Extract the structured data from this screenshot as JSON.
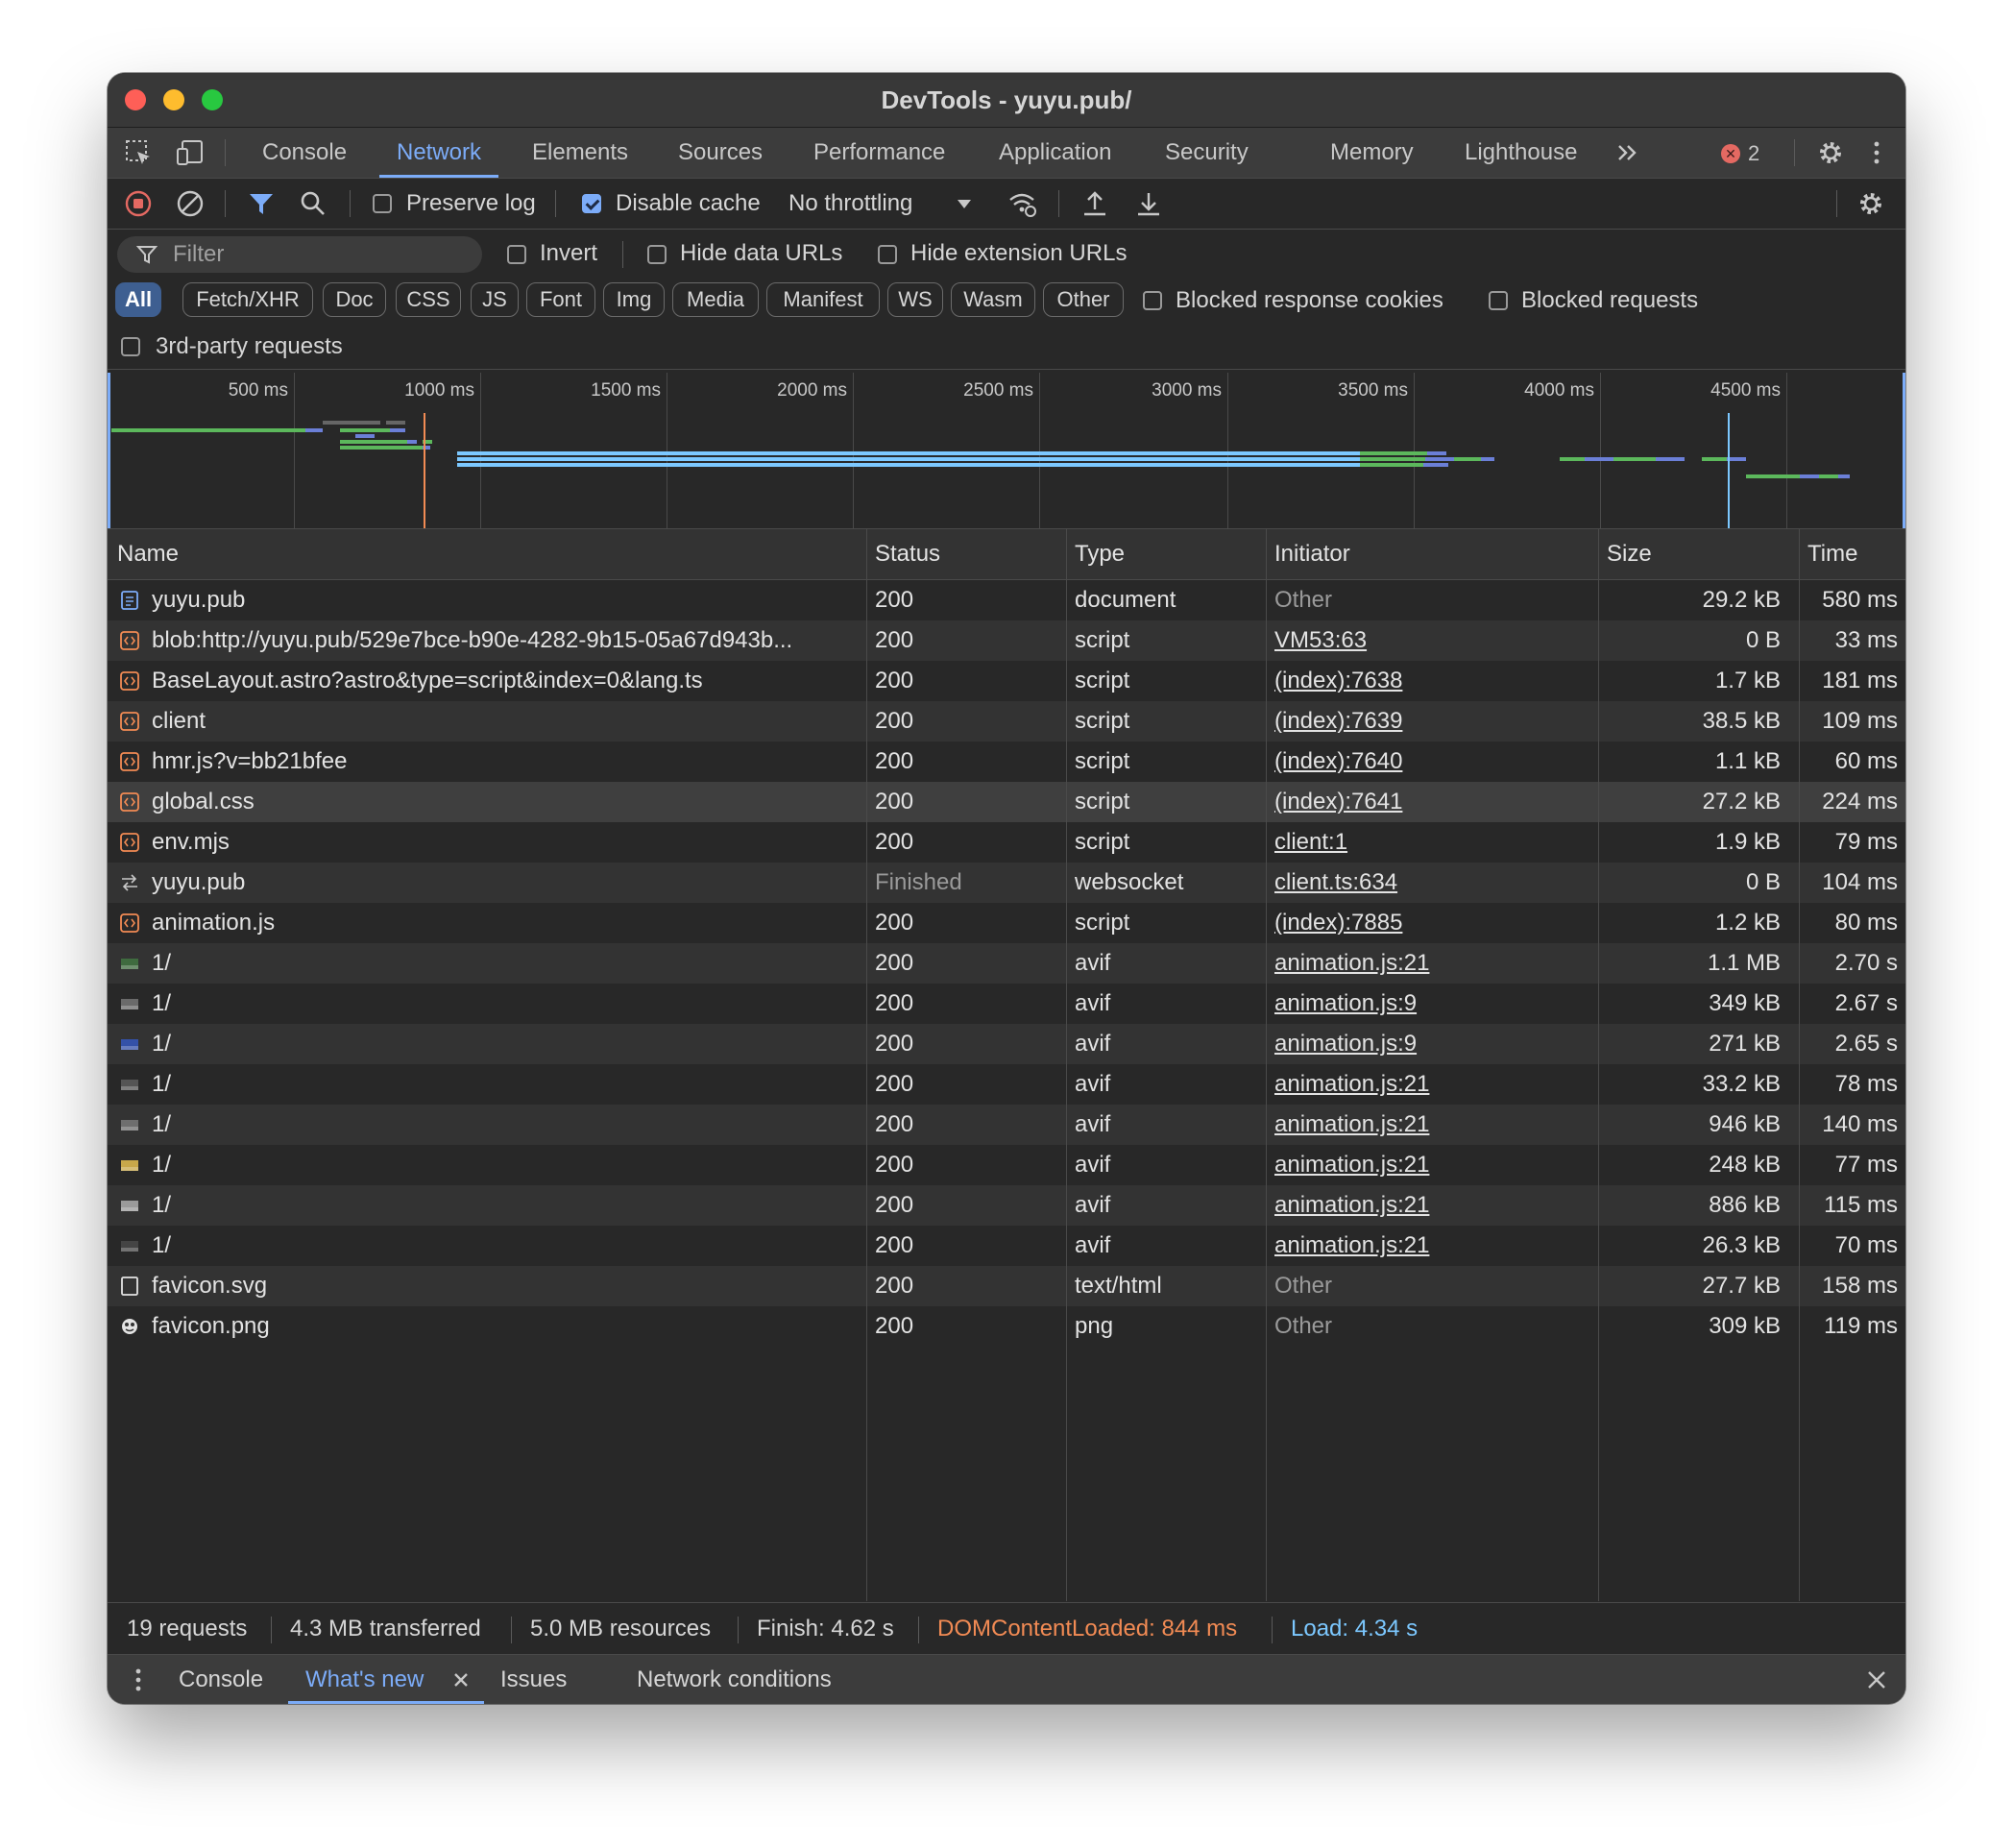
{
  "window": {
    "title": "DevTools - yuyu.pub/"
  },
  "tabs": [
    "Console",
    "Network",
    "Elements",
    "Sources",
    "Performance",
    "Application",
    "Security",
    "Memory",
    "Lighthouse"
  ],
  "active_tab": "Network",
  "error_count": "2",
  "toolbar": {
    "preserve_log": "Preserve log",
    "disable_cache": "Disable cache",
    "throttling": "No throttling"
  },
  "filter": {
    "placeholder": "Filter",
    "invert": "Invert",
    "hide_data_urls": "Hide data URLs",
    "hide_extension_urls": "Hide extension URLs",
    "types": [
      "All",
      "Fetch/XHR",
      "Doc",
      "CSS",
      "JS",
      "Font",
      "Img",
      "Media",
      "Manifest",
      "WS",
      "Wasm",
      "Other"
    ],
    "blocked_response_cookies": "Blocked response cookies",
    "blocked_requests": "Blocked requests",
    "third_party": "3rd-party requests"
  },
  "overview": {
    "ticks": [
      "500 ms",
      "1000 ms",
      "1500 ms",
      "2000 ms",
      "2500 ms",
      "3000 ms",
      "3500 ms",
      "4000 ms",
      "4500 ms"
    ]
  },
  "table": {
    "headers": {
      "name": "Name",
      "status": "Status",
      "type": "Type",
      "initiator": "Initiator",
      "size": "Size",
      "time": "Time"
    },
    "rows": [
      {
        "name": "yuyu.pub",
        "status": "200",
        "type": "document",
        "initiator": "Other",
        "size": "29.2 kB",
        "time": "580 ms",
        "icon": "document-icon"
      },
      {
        "name": "blob:http://yuyu.pub/529e7bce-b90e-4282-9b15-05a67d943b...",
        "status": "200",
        "type": "script",
        "initiator": "VM53:63",
        "size": "0 B",
        "time": "33 ms",
        "icon": "script-icon"
      },
      {
        "name": "BaseLayout.astro?astro&type=script&index=0&lang.ts",
        "status": "200",
        "type": "script",
        "initiator": "(index):7638",
        "size": "1.7 kB",
        "time": "181 ms",
        "icon": "script-icon"
      },
      {
        "name": "client",
        "status": "200",
        "type": "script",
        "initiator": "(index):7639",
        "size": "38.5 kB",
        "time": "109 ms",
        "icon": "script-icon"
      },
      {
        "name": "hmr.js?v=bb21bfee",
        "status": "200",
        "type": "script",
        "initiator": "(index):7640",
        "size": "1.1 kB",
        "time": "60 ms",
        "icon": "script-icon"
      },
      {
        "name": "global.css",
        "status": "200",
        "type": "script",
        "initiator": "(index):7641",
        "size": "27.2 kB",
        "time": "224 ms",
        "icon": "script-icon"
      },
      {
        "name": "env.mjs",
        "status": "200",
        "type": "script",
        "initiator": "client:1",
        "size": "1.9 kB",
        "time": "79 ms",
        "icon": "script-icon"
      },
      {
        "name": "yuyu.pub",
        "status": "Finished",
        "type": "websocket",
        "initiator": "client.ts:634",
        "size": "0 B",
        "time": "104 ms",
        "icon": "websocket-icon"
      },
      {
        "name": "animation.js",
        "status": "200",
        "type": "script",
        "initiator": "(index):7885",
        "size": "1.2 kB",
        "time": "80 ms",
        "icon": "script-icon"
      },
      {
        "name": "1/",
        "status": "200",
        "type": "avif",
        "initiator": "animation.js:21",
        "size": "1.1 MB",
        "time": "2.70 s",
        "icon": "image-thumbnail-icon"
      },
      {
        "name": "1/",
        "status": "200",
        "type": "avif",
        "initiator": "animation.js:9",
        "size": "349 kB",
        "time": "2.67 s",
        "icon": "image-thumbnail-icon"
      },
      {
        "name": "1/",
        "status": "200",
        "type": "avif",
        "initiator": "animation.js:9",
        "size": "271 kB",
        "time": "2.65 s",
        "icon": "image-thumbnail-icon"
      },
      {
        "name": "1/",
        "status": "200",
        "type": "avif",
        "initiator": "animation.js:21",
        "size": "33.2 kB",
        "time": "78 ms",
        "icon": "image-thumbnail-icon"
      },
      {
        "name": "1/",
        "status": "200",
        "type": "avif",
        "initiator": "animation.js:21",
        "size": "946 kB",
        "time": "140 ms",
        "icon": "image-thumbnail-icon"
      },
      {
        "name": "1/",
        "status": "200",
        "type": "avif",
        "initiator": "animation.js:21",
        "size": "248 kB",
        "time": "77 ms",
        "icon": "image-thumbnail-icon"
      },
      {
        "name": "1/",
        "status": "200",
        "type": "avif",
        "initiator": "animation.js:21",
        "size": "886 kB",
        "time": "115 ms",
        "icon": "image-thumbnail-icon"
      },
      {
        "name": "1/",
        "status": "200",
        "type": "avif",
        "initiator": "animation.js:21",
        "size": "26.3 kB",
        "time": "70 ms",
        "icon": "image-thumbnail-icon"
      },
      {
        "name": "favicon.svg",
        "status": "200",
        "type": "text/html",
        "initiator": "Other",
        "size": "27.7 kB",
        "time": "158 ms",
        "icon": "blank-file-icon"
      },
      {
        "name": "favicon.png",
        "status": "200",
        "type": "png",
        "initiator": "Other",
        "size": "309 kB",
        "time": "119 ms",
        "icon": "favicon-image-icon"
      }
    ]
  },
  "status": {
    "requests": "19 requests",
    "transferred": "4.3 MB transferred",
    "resources": "5.0 MB resources",
    "finish": "Finish: 4.62 s",
    "dom_content_loaded": "DOMContentLoaded: 844 ms",
    "load": "Load: 4.34 s"
  },
  "drawer": {
    "tabs": [
      "Console",
      "What's new",
      "Issues",
      "Network conditions"
    ],
    "active_tab": "What's new"
  },
  "colors": {
    "accent": "#7cacf8",
    "dom_content_loaded": "#f28b54",
    "load": "#7cc8ff",
    "error": "#e46962"
  }
}
